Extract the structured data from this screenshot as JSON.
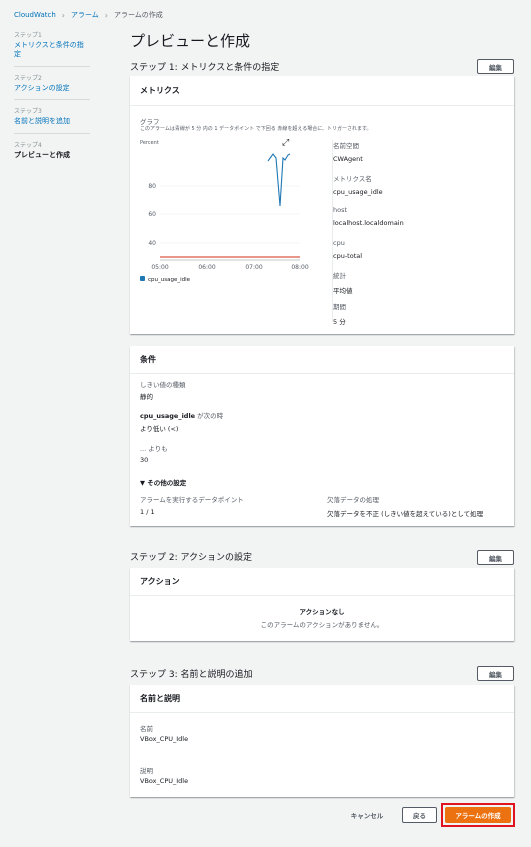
{
  "breadcrumb": [
    "CloudWatch",
    "アラーム",
    "アラームの作成"
  ],
  "steps": [
    {
      "num": "ステップ1",
      "label": "メトリクスと条件の指定"
    },
    {
      "num": "ステップ2",
      "label": "アクションの設定"
    },
    {
      "num": "ステップ3",
      "label": "名前と説明を追加"
    },
    {
      "num": "ステップ4",
      "label": "プレビューと作成"
    }
  ],
  "page_title": "プレビューと作成",
  "edit_label": "編集",
  "step1": {
    "header": "ステップ 1: メトリクスと条件の指定",
    "metrics_title": "メトリクス",
    "graph_label": "グラフ",
    "graph_desc": "このアラームは青線が 5 分 内の 1 データポイント で下回る 赤線を超える場合に、トリガーされます。",
    "chart": {
      "unit": "Percent",
      "y_ticks": [
        "80",
        "60",
        "40"
      ],
      "x_ticks": [
        "05:00",
        "06:00",
        "07:00",
        "08:00"
      ],
      "legend": "cpu_usage_idle"
    },
    "details": [
      {
        "label": "名前空間",
        "value": "CWAgent"
      },
      {
        "label": "メトリクス名",
        "value": "cpu_usage_idle"
      },
      {
        "label": "host",
        "value": "localhost.localdomain"
      },
      {
        "label": "cpu",
        "value": "cpu-total"
      },
      {
        "label": "統計",
        "value": "平均値"
      },
      {
        "label": "期間",
        "value": "5 分"
      }
    ],
    "conditions_title": "条件",
    "threshold_type_label": "しきい値の種類",
    "threshold_type_value": "静的",
    "when_metric": "cpu_usage_idle",
    "when_suffix": " が次の時",
    "when_value": "より低い (<)",
    "than_label": "... よりも",
    "than_value": "30",
    "additional_label": "その他の設定",
    "datapoints_label": "アラームを実行するデータポイント",
    "datapoints_value": "1 / 1",
    "missing_label": "欠落データの処理",
    "missing_value": "欠落データを不正 (しきい値を超えている)として処理"
  },
  "step2": {
    "header": "ステップ 2: アクションの設定",
    "actions_title": "アクション",
    "no_actions": "アクションなし",
    "no_actions_desc": "このアラームのアクションがありません。"
  },
  "step3": {
    "header": "ステップ 3: 名前と説明の追加",
    "card_title": "名前と説明",
    "name_label": "名前",
    "name_value": "VBox_CPU_Idle",
    "desc_label": "説明",
    "desc_value": "VBox_CPU_Idle"
  },
  "footer": {
    "cancel": "キャンセル",
    "back": "戻る",
    "create": "アラームの作成"
  },
  "colors": {
    "link": "#0073bb",
    "primary": "#ec7211",
    "highlight": "#e0141e",
    "series": "#1f77b4",
    "threshold": "#d13212"
  }
}
